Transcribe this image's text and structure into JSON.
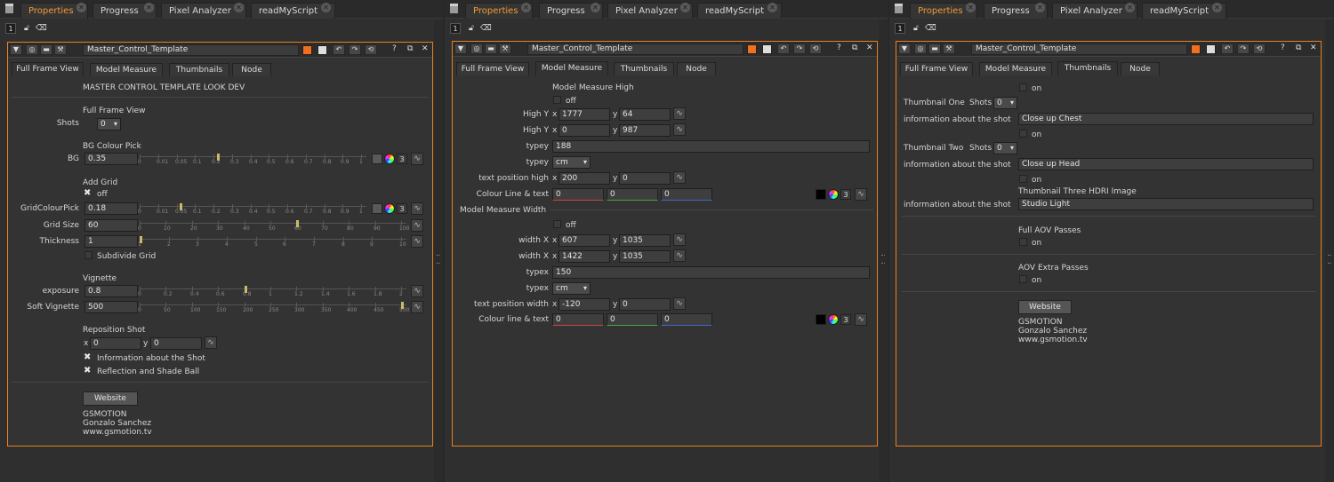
{
  "tabs": [
    "Properties",
    "Progress",
    "Pixel Analyzer",
    "readMyScript"
  ],
  "toolbar": {
    "num": "1"
  },
  "node_name": "Master_Control_Template",
  "subtabs": [
    "Full Frame View",
    "Model Measure",
    "Thumbnails",
    "Node"
  ],
  "p1": {
    "title": "MASTER CONTROL TEMPLATE LOOK DEV",
    "ffv": "Full Frame View",
    "shots_lbl": "Shots",
    "shots_val": "0",
    "bgpick": "BG Colour Pick",
    "bg_lbl": "BG",
    "bg_val": "0.35",
    "bg_ticks": [
      "0",
      "0.01",
      "0.05",
      "0.1",
      "0.2",
      "0.3",
      "0.4",
      "0.5",
      "0.6",
      "0.7",
      "0.8",
      "0.9",
      "1"
    ],
    "cnum": "3",
    "addgrid": "Add Grid",
    "off": "off",
    "gcp_lbl": "GridColourPick",
    "gcp_val": "0.18",
    "gs_lbl": "Grid Size",
    "gs_val": "60",
    "gs_ticks": [
      "0",
      "10",
      "20",
      "30",
      "40",
      "50",
      "60",
      "70",
      "80",
      "90",
      "100"
    ],
    "th_lbl": "Thickness",
    "th_val": "1",
    "th_ticks": [
      "1",
      "2",
      "3",
      "4",
      "5",
      "6",
      "7",
      "8",
      "9",
      "10"
    ],
    "subdiv": "Subdivide Grid",
    "vignette": "Vignette",
    "exp_lbl": "exposure",
    "exp_val": "0.8",
    "exp_ticks": [
      "0",
      "0.2",
      "0.4",
      "0.6",
      "0.8",
      "1",
      "1.2",
      "1.4",
      "1.6",
      "1.8",
      "2"
    ],
    "sv_lbl": "Soft Vignette",
    "sv_val": "500",
    "sv_ticks": [
      "0",
      "50",
      "100",
      "150",
      "200",
      "250",
      "300",
      "350",
      "400",
      "450",
      "500"
    ],
    "repo": "Reposition Shot",
    "x": "x",
    "y": "y",
    "rx": "0",
    "ry": "0",
    "info": "Information about the Shot",
    "refl": "Reflection and Shade Ball",
    "website": "Website",
    "credits": [
      "GSMOTION",
      "Gonzalo Sanchez",
      "www.gsmotion.tv"
    ]
  },
  "p2": {
    "mmh": "Model Measure High",
    "off": "off",
    "hy1_lbl": "High Y",
    "hy1_x": "1777",
    "hy1_y": "64",
    "hy2_lbl": "High Y",
    "hy2_x": "0",
    "hy2_y": "987",
    "typey_lbl": "typey",
    "typey_val": "188",
    "typey2_lbl": "typey",
    "unit": "cm",
    "tph_lbl": "text position high",
    "tph_x": "200",
    "tph_y": "0",
    "clt_lbl": "Colour Line & text",
    "c0": "0",
    "cnum": "3",
    "mmw": "Model Measure Width",
    "wx1_lbl": "width X",
    "wx1_x": "607",
    "wx1_y": "1035",
    "wx2_lbl": "width X",
    "wx2_x": "1422",
    "wx2_y": "1035",
    "typex_lbl": "typex",
    "typex_val": "150",
    "typex2_lbl": "typex",
    "tpw_lbl": "text position width",
    "tpw_x": "-120",
    "tpw_y": "0",
    "clt2_lbl": "Colour line & text",
    "x": "x",
    "y": "y"
  },
  "p3": {
    "on": "on",
    "t1_lbl": "Thumbnail One",
    "t1_shots": "Shots",
    "shots_val": "0",
    "info_lbl": "information about the shot",
    "info1": "Close up Chest",
    "t2_lbl": "Thumbnail Two",
    "t2_shots": "Shots",
    "info2": "Close up Head",
    "t3_lbl": "Thumbnail Three HDRI Image",
    "info3": "Studio Light",
    "aov": "Full AOV Passes",
    "aove": "AOV Extra Passes",
    "website": "Website",
    "credits": [
      "GSMOTION",
      "Gonzalo Sanchez",
      "www.gsmotion.tv"
    ]
  },
  "colors": {
    "accent": "#f07020",
    "active_tab": "#f39a32"
  }
}
